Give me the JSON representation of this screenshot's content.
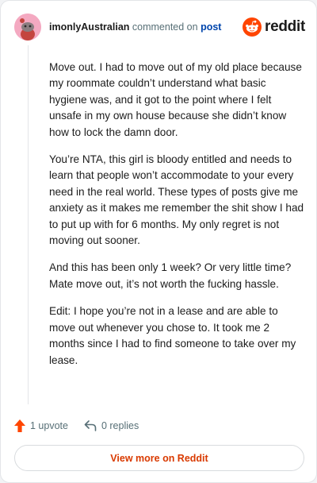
{
  "header": {
    "username": "imonlyAustralian",
    "action_text": "commented on",
    "post_link": "post",
    "brand": "reddit"
  },
  "comment": {
    "paragraphs": [
      "Move out. I had to move out of my old place because my roommate couldn’t understand what basic hygiene was, and it got to the point where I felt unsafe in my own house because she didn’t know how to lock the damn door.",
      "You’re NTA, this girl is bloody entitled and needs to learn that people won’t accommodate to your every need in the real world. These types of posts give me anxiety as it makes me remember the shit show I had to put up with for 6 months. My only regret is not moving out sooner.",
      "And this has been only 1 week? Or very little time? Mate move out, it’s not worth the fucking hassle.",
      "Edit: I hope you’re not in a lease and are able to move out whenever you chose to. It took me 2 months since I had to find someone to take over my lease."
    ]
  },
  "actions": {
    "upvote_label": "1 upvote",
    "replies_label": "0 replies"
  },
  "footer": {
    "view_more_label": "View more on Reddit"
  },
  "colors": {
    "brand_orange": "#ff4500",
    "link_blue": "#0045ac",
    "cta_red": "#d93a00",
    "avatar_pink": "#f4a9c1"
  }
}
